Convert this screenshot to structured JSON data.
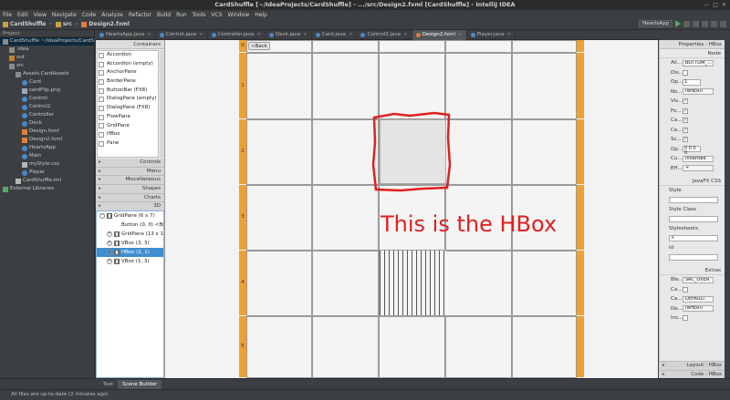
{
  "window": {
    "title": "CardShuffle [~/IdeaProjects/CardShuffle] - .../src/Design2.fxml [CardShuffle] - IntelliJ IDEA"
  },
  "menu": [
    "File",
    "Edit",
    "View",
    "Navigate",
    "Code",
    "Analyze",
    "Refactor",
    "Build",
    "Run",
    "Tools",
    "VCS",
    "Window",
    "Help"
  ],
  "breadcrumbs": [
    "CardShuffle",
    "src",
    "Design2.fxml"
  ],
  "run_config": "HeartsApp",
  "project": {
    "header": "Project",
    "items": [
      {
        "label": "CardShuffle ~/IdeaProjects/CardShuffle",
        "indent": 0,
        "icon": "folder-icon",
        "sel": true
      },
      {
        "label": ".idea",
        "indent": 1,
        "icon": "folder-icon"
      },
      {
        "label": "out",
        "indent": 1,
        "icon": "folder-orange-icon"
      },
      {
        "label": "src",
        "indent": 1,
        "icon": "folder-icon"
      },
      {
        "label": "Assets.CardAssets",
        "indent": 2,
        "icon": "package-icon"
      },
      {
        "label": "Card",
        "indent": 3,
        "icon": "class-icon"
      },
      {
        "label": "cardFlip.png",
        "indent": 3,
        "icon": "image-icon"
      },
      {
        "label": "Control",
        "indent": 3,
        "icon": "class-icon"
      },
      {
        "label": "Control2",
        "indent": 3,
        "icon": "class-icon"
      },
      {
        "label": "Controller",
        "indent": 3,
        "icon": "class-icon"
      },
      {
        "label": "Deck",
        "indent": 3,
        "icon": "class-icon"
      },
      {
        "label": "Design.fxml",
        "indent": 3,
        "icon": "fxml-icon"
      },
      {
        "label": "Design2.fxml",
        "indent": 3,
        "icon": "fxml-icon"
      },
      {
        "label": "HeartsApp",
        "indent": 3,
        "icon": "class-icon"
      },
      {
        "label": "Main",
        "indent": 3,
        "icon": "class-icon"
      },
      {
        "label": "myStyle.css",
        "indent": 3,
        "icon": "file-icon"
      },
      {
        "label": "Player",
        "indent": 3,
        "icon": "class-icon"
      },
      {
        "label": "CardShuffle.iml",
        "indent": 2,
        "icon": "file-icon"
      },
      {
        "label": "External Libraries",
        "indent": 0,
        "icon": "library-icon"
      }
    ]
  },
  "tabs": [
    {
      "label": "HeartsApp.java"
    },
    {
      "label": "Control.java"
    },
    {
      "label": "Controller.java"
    },
    {
      "label": "Deck.java"
    },
    {
      "label": "Card.java"
    },
    {
      "label": "Control2.java"
    },
    {
      "label": "Design2.fxml",
      "active": true
    },
    {
      "label": "Player.java"
    }
  ],
  "library": {
    "header": "Containers",
    "items": [
      "Accordion",
      "Accordion (empty)",
      "AnchorPane",
      "BorderPane",
      "ButtonBar (FX8)",
      "DialogPane (empty)",
      "DialogPane (FX8)",
      "FlowPane",
      "GridPane",
      "HBox",
      "Pane"
    ],
    "sections": [
      "Controls",
      "Menu",
      "Miscellaneous",
      "Shapes",
      "Charts",
      "3D"
    ]
  },
  "hierarchy": [
    {
      "label": "GridPane (6 x 7)",
      "indent": 0,
      "toggle": "⊖",
      "icon": "grid"
    },
    {
      "label": "Button (0, 0) <Bi",
      "indent": 1,
      "toggle": "",
      "icon": "none"
    },
    {
      "label": "GridPane (13 x 1",
      "indent": 1,
      "toggle": "⊕",
      "icon": "grid"
    },
    {
      "label": "VBox (3, 3)",
      "indent": 1,
      "toggle": "⊕",
      "icon": "vbox"
    },
    {
      "label": "HBox (2, 1)",
      "indent": 1,
      "toggle": "⊕",
      "icon": "hbox",
      "sel": true
    },
    {
      "label": "VBox (1, 3)",
      "indent": 1,
      "toggle": "⊕",
      "icon": "vbox"
    }
  ],
  "canvas": {
    "back_button": "<Back",
    "row_labels": [
      "0",
      "1",
      "2",
      "3",
      "4",
      "5"
    ],
    "annotation": "This is the HBox"
  },
  "inspector": {
    "header": "Properties : HBox",
    "node_section": "Node",
    "props": [
      {
        "label": "Ali...",
        "type": "dd",
        "value": "BOTTOM_..."
      },
      {
        "label": "Dis...",
        "type": "cb",
        "value": ""
      },
      {
        "label": "Op...",
        "type": "tf",
        "value": "1"
      },
      {
        "label": "No...",
        "type": "dd",
        "value": "INHERIT"
      },
      {
        "label": "Vis...",
        "type": "cb",
        "value": "✓"
      },
      {
        "label": "Fo...",
        "type": "cb",
        "value": "✓"
      },
      {
        "label": "Ca...",
        "type": "cb",
        "value": "✓"
      },
      {
        "label": "Ce...",
        "type": "cb",
        "value": "✓"
      },
      {
        "label": "Sc...",
        "type": "cb",
        "value": "✓"
      },
      {
        "label": "Op...",
        "type": "tf",
        "value": "0 0 0 0"
      },
      {
        "label": "Cu...",
        "type": "dd",
        "value": "Inherited"
      },
      {
        "label": "Eff...",
        "type": "dd",
        "value": "+"
      }
    ],
    "css_section": "JavaFX CSS",
    "style_label": "Style",
    "styleclass_label": "Style Class",
    "stylesheets_label": "Stylesheets",
    "id_label": "id",
    "extras_section": "Extras",
    "extras": [
      {
        "label": "Ble...",
        "type": "dd",
        "value": "SRC_OVER"
      },
      {
        "label": "Ca...",
        "type": "cb",
        "value": ""
      },
      {
        "label": "Ca...",
        "type": "dd",
        "value": "DEFAULT"
      },
      {
        "label": "De...",
        "type": "dd",
        "value": "INHERIT"
      },
      {
        "label": "Ins...",
        "type": "cb",
        "value": ""
      }
    ],
    "bottom_sections": [
      "Layout : HBox",
      "Code : HBox"
    ]
  },
  "bottom_tabs": [
    {
      "label": "Text"
    },
    {
      "label": "Scene Builder",
      "active": true
    }
  ],
  "status": "All files are up-to-date (2 minutes ago)",
  "colors": {
    "accent": "#f0a030",
    "annotation": "#e02020",
    "selection": "#3e8ed0"
  }
}
